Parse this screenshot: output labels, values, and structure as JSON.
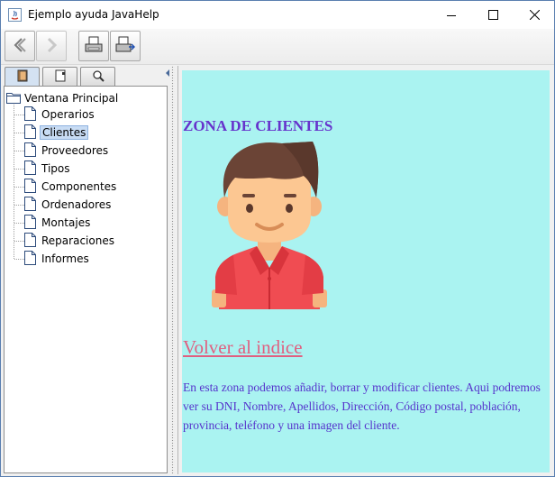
{
  "window": {
    "title": "Ejemplo ayuda JavaHelp",
    "controls": [
      "minimize-icon",
      "maximize-icon",
      "close-icon"
    ]
  },
  "toolbar": {
    "buttons": [
      {
        "icon": "back-arrow-icon",
        "enabled": true
      },
      {
        "icon": "forward-arrow-icon",
        "enabled": false
      },
      {
        "icon": "print-icon",
        "enabled": true
      },
      {
        "icon": "page-setup-icon",
        "enabled": true
      }
    ]
  },
  "navigator": {
    "tabs": [
      {
        "icon": "book-contents-icon",
        "active": true
      },
      {
        "icon": "index-book-icon",
        "active": false
      },
      {
        "icon": "search-magnifier-icon",
        "active": false
      }
    ],
    "tree": {
      "root": "Ventana Principal",
      "items": [
        "Operarios",
        "Clientes",
        "Proveedores",
        "Tipos",
        "Componentes",
        "Ordenadores",
        "Montajes",
        "Reparaciones",
        "Informes"
      ],
      "selected": "Clientes"
    }
  },
  "content": {
    "heading": "ZONA DE CLIENTES",
    "image": "client-avatar-icon",
    "link_text": "Volver al indice",
    "description": "En esta zona podemos añadir, borrar y modificar clientes. Aqui podremos ver su DNI, Nombre, Apellidos, Dirección, Código postal, población, provincia, teléfono y una imagen del cliente.",
    "colors": {
      "background": "#aaf3f1",
      "heading": "#6633cc",
      "link": "#e06080",
      "text": "#5533cc"
    }
  }
}
